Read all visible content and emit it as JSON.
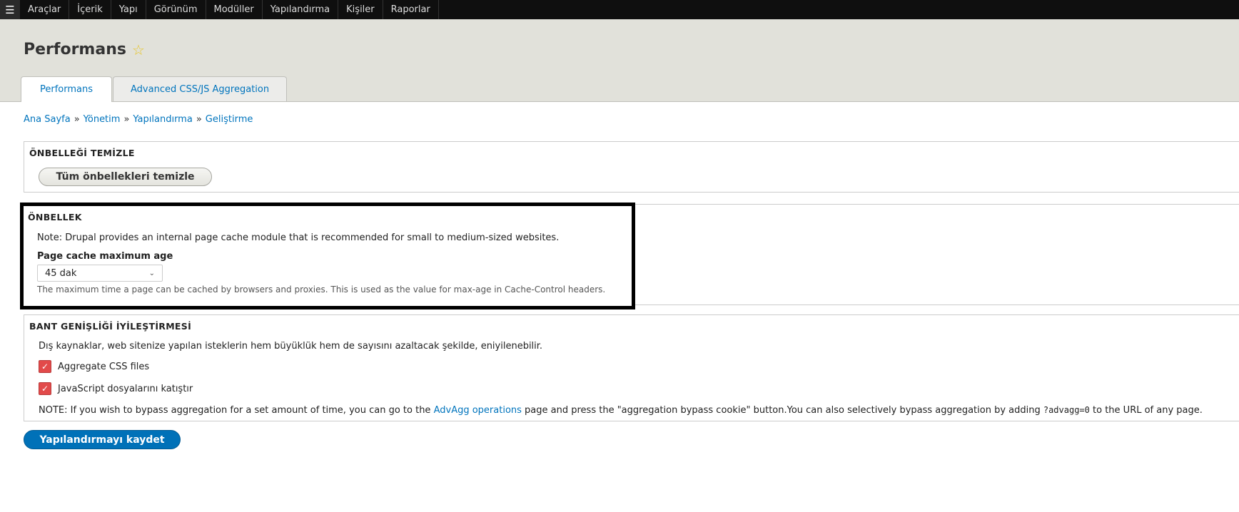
{
  "toolbar": {
    "menu_icon": "hamburger-icon",
    "items": [
      "Araçlar",
      "İçerik",
      "Yapı",
      "Görünüm",
      "Modüller",
      "Yapılandırma",
      "Kişiler",
      "Raporlar"
    ]
  },
  "header": {
    "title": "Performans",
    "star_icon": "star-icon",
    "tabs": [
      {
        "label": "Performans",
        "active": true
      },
      {
        "label": "Advanced CSS/JS Aggregation",
        "active": false
      }
    ]
  },
  "breadcrumb": [
    "Ana Sayfa",
    "Yönetim",
    "Yapılandırma",
    "Geliştirme"
  ],
  "breadcrumb_sep": "»",
  "clear_cache": {
    "legend": "ÖNBELLEĞİ TEMİZLE",
    "button": "Tüm önbellekleri temizle"
  },
  "cache": {
    "legend": "ÖNBELLEK",
    "note": "Note: Drupal provides an internal page cache module that is recommended for small to medium-sized websites.",
    "max_age_label": "Page cache maximum age",
    "max_age_value": "45 dak",
    "max_age_desc": "The maximum time a page can be cached by browsers and proxies. This is used as the value for max-age in Cache-Control headers."
  },
  "bandwidth": {
    "legend": "BANT GENİŞLİĞİ İYİLEŞTİRMESİ",
    "desc": "Dış kaynaklar, web sitenize yapılan isteklerin hem büyüklük hem de sayısını azaltacak şekilde, eniyilenebilir.",
    "checkboxes": [
      {
        "label": "Aggregate CSS files",
        "checked": true
      },
      {
        "label": "JavaScript dosyalarını katıştır",
        "checked": true
      }
    ],
    "note_before": "NOTE: If you wish to bypass aggregation for a set amount of time, you can go to the ",
    "note_link": "AdvAgg operations",
    "note_middle": " page and press the \"aggregation bypass cookie\" button.You can also selectively bypass aggregation by adding ",
    "note_code": "?advagg=0",
    "note_after": " to the URL of any page."
  },
  "save_button": "Yapılandırmayı kaydet",
  "colors": {
    "link": "#0074bd",
    "primary_button": "#0071b8",
    "checkbox": "#e24a4a",
    "toolbar": "#0f0f0f",
    "header_bg": "#e1e1da"
  }
}
